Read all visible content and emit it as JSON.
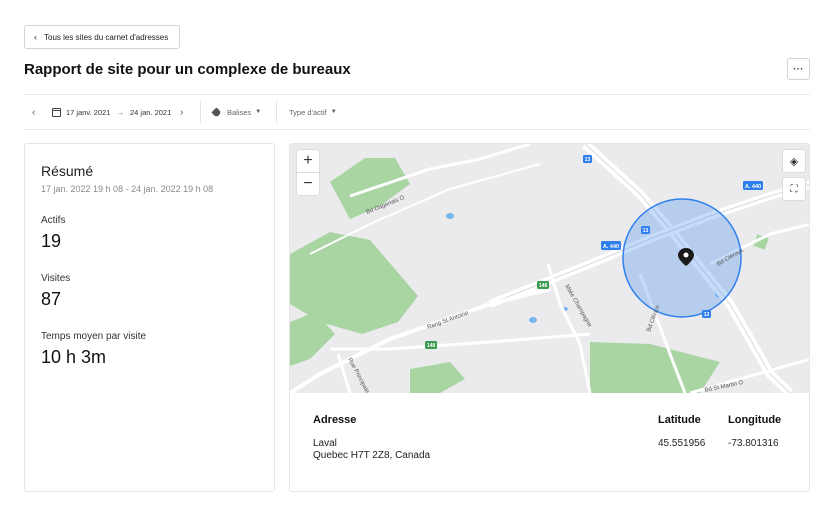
{
  "header": {
    "back_label": "Tous les sites du carnet d'adresses",
    "title": "Rapport de site pour un complexe de bureaux",
    "more_label": "···"
  },
  "filters": {
    "start_date": "17 janv. 2021",
    "end_date": "24 jan. 2021",
    "tags_label": "Balises",
    "asset_type_label": "Type d'actif"
  },
  "summary": {
    "title": "Résumé",
    "range": "17 jan. 2022 19 h 08 - 24 jan. 2022 19 h 08",
    "stats": [
      {
        "label": "Actifs",
        "value": "19"
      },
      {
        "label": "Visites",
        "value": "87"
      },
      {
        "label": "Temps moyen par visite",
        "value": "10 h 3m"
      }
    ]
  },
  "map": {
    "labels": {
      "bd_dagenais": "Bd Dagenais O",
      "rang_st_antoine": "Rang St Antoine",
      "rue_principale": "Rue Principale",
      "montee_champagne": "Mtée Champagne",
      "bd_clerico": "Bd Clérico",
      "bd_cleroux": "Bd Cléroux",
      "bd_st_martin": "Bd St Martin O",
      "a440_right": "A. 440",
      "a440_mid": "A. 440",
      "r148_a": "148",
      "r148_b": "148",
      "r13_top": "13",
      "r13_mid": "13",
      "r13_low": "13"
    },
    "colors": {
      "geofence": "#2f80ed",
      "park": "#a8d5a2",
      "water": "#7ab6f0"
    }
  },
  "address": {
    "headers": {
      "address": "Adresse",
      "latitude": "Latitude",
      "longitude": "Longitude"
    },
    "line1": "Laval",
    "line2": "Quebec H7T 2Z8, Canada",
    "latitude": "45.551956",
    "longitude": "-73.801316"
  }
}
